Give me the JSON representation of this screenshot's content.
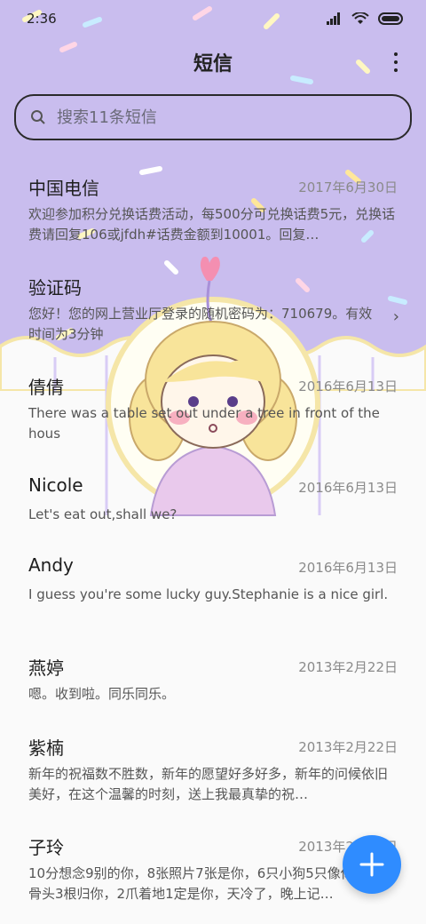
{
  "status_bar": {
    "time": "2:36"
  },
  "header": {
    "title": "短信"
  },
  "search": {
    "placeholder": "搜索11条短信"
  },
  "messages": [
    {
      "sender": "中国电信",
      "date": "2017年6月30日",
      "preview": "欢迎参加积分兑换话费活动，每500分可兑换话费5元，兑换话费请回复106或jfdh#话费金额到10001。回复…"
    },
    {
      "sender": "验证码",
      "date": "",
      "preview": "您好！您的网上营业厅登录的随机密码为：710679。有效时间为3分钟"
    },
    {
      "sender": "倩倩",
      "date": "2016年6月13日",
      "preview": "There was a table set out under a tree in front of the hous"
    },
    {
      "sender": "Nicole",
      "date": "2016年6月13日",
      "preview": "Let's eat out,shall we?"
    },
    {
      "sender": "Andy",
      "date": "2016年6月13日",
      "preview": "I guess you're some lucky guy.Stephanie is a nice girl."
    },
    {
      "sender": "燕婷",
      "date": "2013年2月22日",
      "preview": "嗯。收到啦。同乐同乐。"
    },
    {
      "sender": "紫楠",
      "date": "2013年2月22日",
      "preview": "新年的祝福数不胜数，新年的愿望好多好多，新年的问候依旧美好，在这个温馨的时刻，送上我最真挚的祝…"
    },
    {
      "sender": "子玲",
      "date": "2013年2月22日",
      "preview": "10分想念9别的你，8张照片7张是你，6只小狗5只像你，4根骨头3根归你，2爪着地1定是你，天冷了，晚上记…"
    }
  ],
  "colors": {
    "header_bg": "#c9bdee",
    "fab": "#2f8cff"
  },
  "icons": {
    "search": "search-icon",
    "more": "more-vertical-icon",
    "fab": "plus-icon",
    "chevron": "chevron-right-icon"
  }
}
